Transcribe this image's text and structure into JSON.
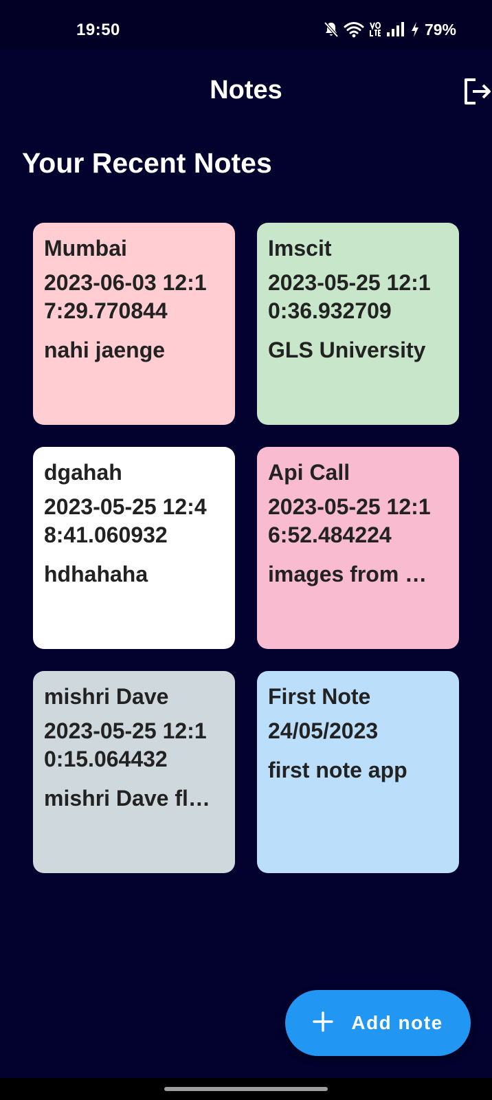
{
  "status_bar": {
    "time": "19:50",
    "battery": "79%",
    "icons": [
      "bell-muted-icon",
      "wifi-icon",
      "volte-icon",
      "signal-icon",
      "charging-bolt-icon"
    ]
  },
  "app_bar": {
    "title": "Notes",
    "logout_icon": "logout-icon"
  },
  "section": {
    "heading": "Your Recent Notes"
  },
  "notes": [
    {
      "title": "Mumbai",
      "date": "2023-06-03 12:17:29.770844",
      "body": "nahi jaenge",
      "color": "#ffcdd2"
    },
    {
      "title": "Imscit",
      "date": "2023-05-25 12:10:36.932709",
      "body": "GLS University",
      "color": "#c8e6c9"
    },
    {
      "title": "dgahah",
      "date": "2023-05-25 12:48:41.060932",
      "body": "hdhahaha",
      "color": "#ffffff"
    },
    {
      "title": "Api Call",
      "date": "2023-05-25 12:16:52.484224",
      "body": "images from …",
      "color": "#f8bbd0"
    },
    {
      "title": "mishri Dave",
      "date": "2023-05-25 12:10:15.064432",
      "body": "mishri Dave fl…",
      "color": "#cfd8dc"
    },
    {
      "title": "First Note",
      "date": "24/05/2023",
      "body": "first note app",
      "color": "#bbdefb"
    }
  ],
  "fab": {
    "label": "Add note",
    "icon": "plus-icon",
    "color": "#2196f3"
  },
  "colors": {
    "background": "#03022e",
    "status_bar": "#020125"
  }
}
